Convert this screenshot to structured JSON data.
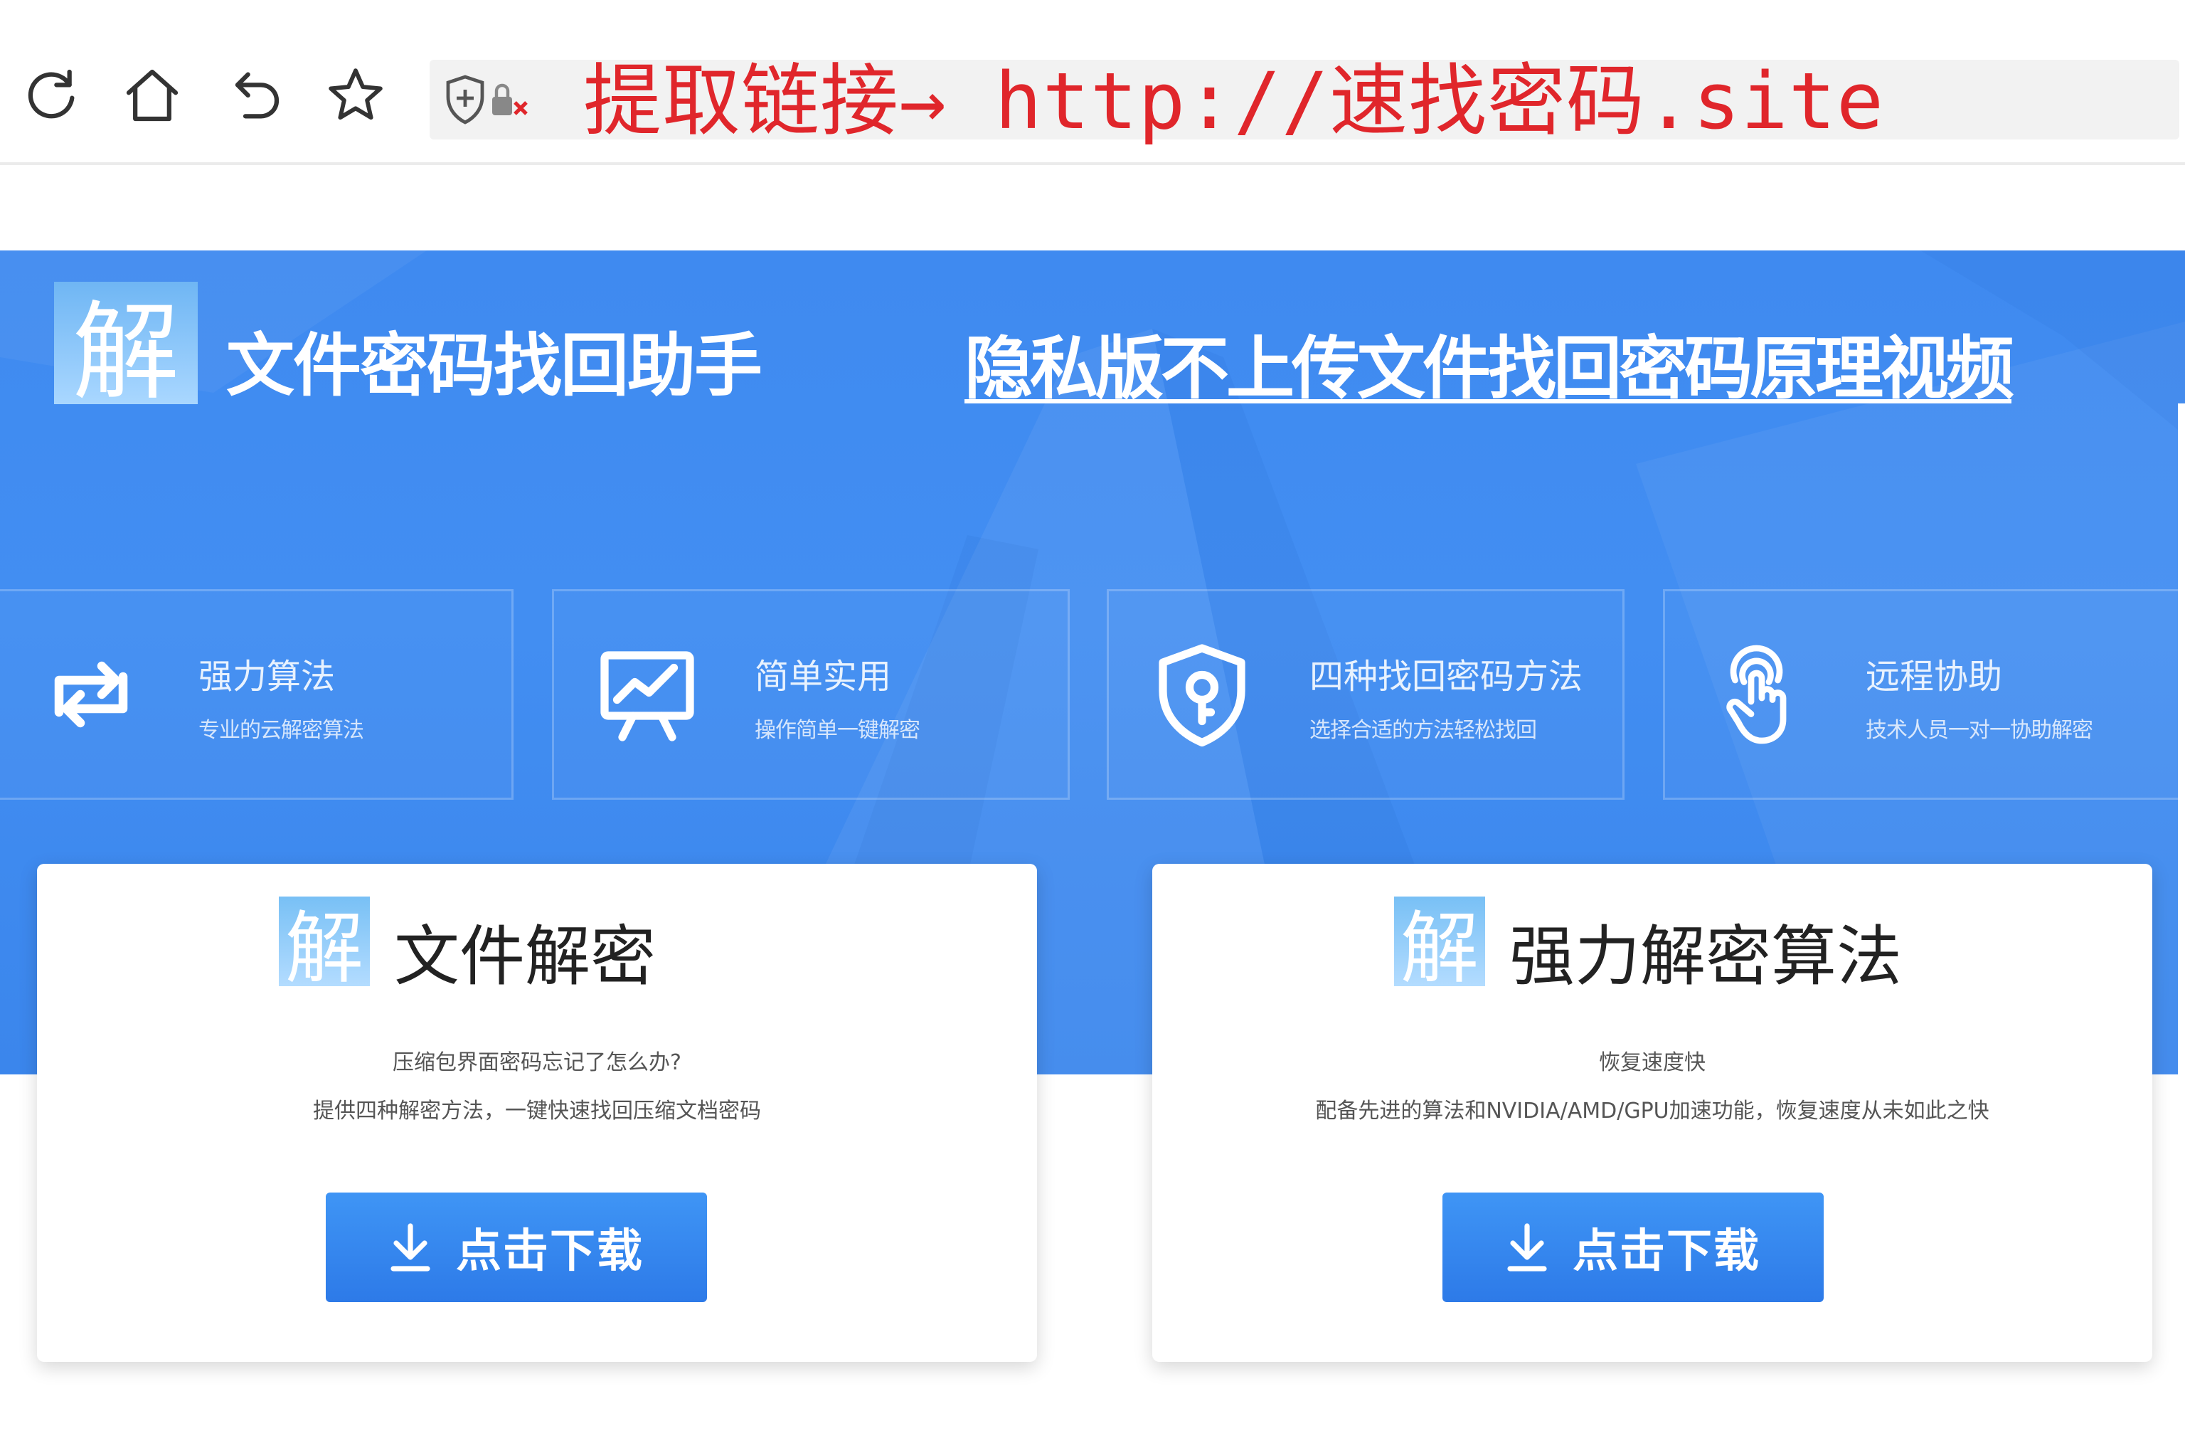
{
  "toolbar": {
    "icons": [
      "reload-icon",
      "home-icon",
      "undo-icon",
      "bookmark-star-icon",
      "security-shield-icon"
    ],
    "url_text": "提取链接→ http://速找密码.site"
  },
  "header": {
    "logo_char": "解",
    "title": "文件密码找回助手",
    "video_link": "隐私版不上传文件找回密码原理视频"
  },
  "features": [
    {
      "icon": "refresh-arrows-icon",
      "title": "强力算法",
      "desc": "专业的云解密算法"
    },
    {
      "icon": "presentation-chart-icon",
      "title": "简单实用",
      "desc": "操作简单一键解密"
    },
    {
      "icon": "shield-key-icon",
      "title": "四种找回密码方法",
      "desc": "选择合适的方法轻松找回"
    },
    {
      "icon": "touch-hand-icon",
      "title": "远程协助",
      "desc": "技术人员一对一协助解密"
    }
  ],
  "cards": [
    {
      "logo_char": "解",
      "title": "文件解密",
      "line1": "压缩包界面密码忘记了怎么办?",
      "line2": "提供四种解密方法，一键快速找回压缩文档密码",
      "button": "点击下载"
    },
    {
      "logo_char": "解",
      "title": "强力解密算法",
      "line1": "恢复速度快",
      "line2": "配备先进的算法和NVIDIA/AMD/GPU加速功能，恢复速度从未如此之快",
      "button": "点击下载"
    }
  ],
  "colors": {
    "banner_blue": "#428ef2",
    "url_red": "#e0262b",
    "button_blue": "#2d7ae8"
  }
}
